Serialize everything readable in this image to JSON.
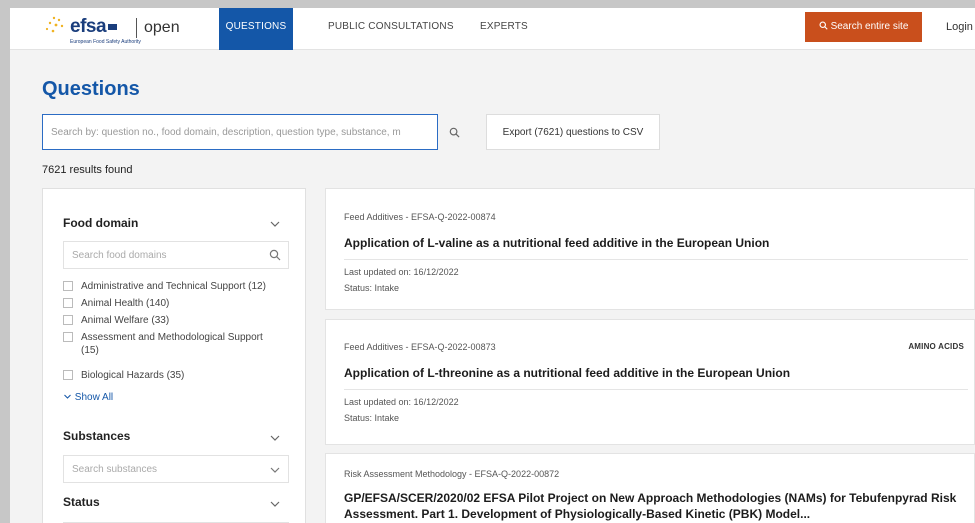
{
  "header": {
    "logo_text": "efsa",
    "logo_tagline": "European Food Safety Authority",
    "logo_suffix": "open",
    "nav": [
      {
        "label": "QUESTIONS",
        "active": true
      },
      {
        "label": "PUBLIC CONSULTATIONS",
        "active": false
      },
      {
        "label": "EXPERTS",
        "active": false
      }
    ],
    "search_site_label": "Search entire site",
    "login_label": "Login"
  },
  "page": {
    "title": "Questions",
    "search_placeholder": "Search by: question no., food domain, description, question type, substance, m",
    "export_label": "Export (7621) questions to CSV",
    "results_text": "7621 results found"
  },
  "filters": {
    "food_domain": {
      "title": "Food domain",
      "search_placeholder": "Search food domains",
      "options": [
        "Administrative and Technical Support (12)",
        "Animal Health (140)",
        "Animal Welfare (33)",
        "Assessment and Methodological Support (15)",
        "Biological Hazards (35)"
      ],
      "show_all_label": "Show All"
    },
    "substances": {
      "title": "Substances",
      "search_placeholder": "Search substances"
    },
    "status": {
      "title": "Status"
    }
  },
  "results": [
    {
      "meta": "Feed Additives - EFSA-Q-2022-00874",
      "title": "Application of L-valine as a nutritional feed additive in the European Union",
      "updated": "Last updated on: 16/12/2022",
      "status": "Status: Intake",
      "tag": ""
    },
    {
      "meta": "Feed Additives - EFSA-Q-2022-00873",
      "title": "Application of L-threonine as a nutritional feed additive in the European Union",
      "updated": "Last updated on: 16/12/2022",
      "status": "Status: Intake",
      "tag": "AMINO ACIDS"
    },
    {
      "meta": "Risk Assessment Methodology - EFSA-Q-2022-00872",
      "title": "GP/EFSA/SCER/2020/02 EFSA Pilot Project on New Approach Methodologies (NAMs) for Tebufenpyrad Risk Assessment. Part 1. Development of Physiologically-Based Kinetic (PBK) Model..."
    }
  ],
  "colors": {
    "brand_blue": "#1457a8",
    "accent_orange": "#c94f1c"
  }
}
